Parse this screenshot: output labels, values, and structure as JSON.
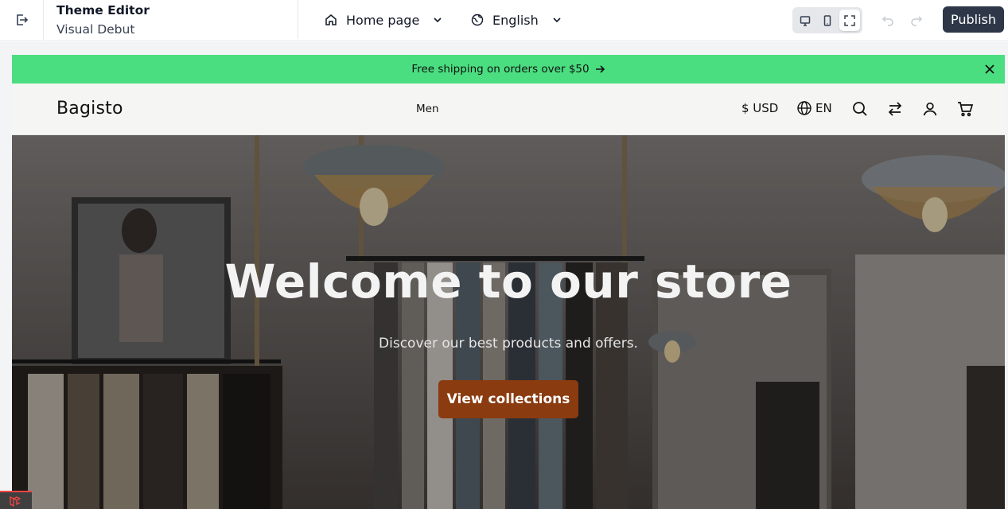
{
  "editor": {
    "title": "Theme Editor",
    "subtitle": "Visual Debut",
    "page_select": "Home page",
    "language_select": "English",
    "publish_label": "Publish",
    "devices": [
      "desktop-icon",
      "mobile-icon",
      "fullscreen-icon"
    ],
    "active_device": "fullscreen-icon"
  },
  "storefront": {
    "announcement": "Free shipping on orders over $50",
    "logo": "Bagisto",
    "nav": [
      "Men"
    ],
    "currency": "$ USD",
    "language": "EN",
    "header_icons": [
      "search-icon",
      "compare-icon",
      "user-icon",
      "cart-icon"
    ],
    "hero": {
      "title": "Welcome to our store",
      "subtitle": "Discover our best products and offers.",
      "button_label": "View collections"
    }
  },
  "colors": {
    "announcement_bg": "#4ade80",
    "publish_bg": "#2d3748",
    "hero_button": "#8a3b10"
  }
}
